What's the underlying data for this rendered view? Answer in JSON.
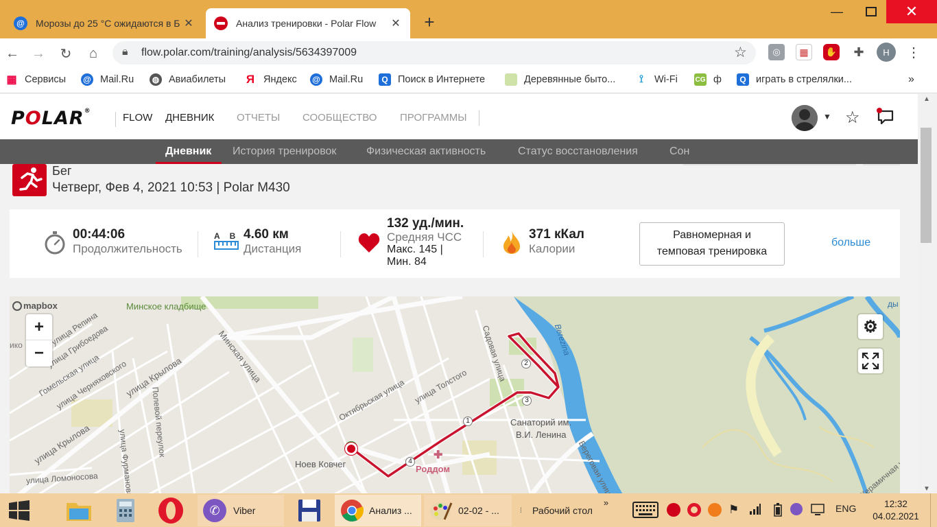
{
  "browser": {
    "tabs": [
      {
        "title": "Морозы до 25 °C ожидаются в Б",
        "active": false
      },
      {
        "title": "Анализ тренировки - Polar Flow",
        "active": true
      }
    ],
    "url": "flow.polar.com/training/analysis/5634397009",
    "profile_initial": "Н",
    "bookmarks": [
      "Сервисы",
      "Mail.Ru",
      "Авиабилеты",
      "Яндекс",
      "Mail.Ru",
      "Поиск в Интернете",
      "Деревянные быто...",
      "Wi-Fi",
      "ф",
      "играть в стрелялки..."
    ],
    "bookmarks_more": "»"
  },
  "site": {
    "logo": "POLAR",
    "logo_mark": "®",
    "product": "FLOW",
    "main_nav": [
      "ДНЕВНИК",
      "ОТЧЕТЫ",
      "СООБЩЕСТВО",
      "ПРОГРАММЫ"
    ],
    "sub_nav": [
      "Дневник",
      "История тренировок",
      "Физическая активность",
      "Статус восстановления",
      "Сон"
    ],
    "accent": "#d0021b"
  },
  "training": {
    "sport": "Бег",
    "datetime_device": "Четверг, Фев 4, 2021 10:53 | Polar M430",
    "duration_value": "00:44:06",
    "duration_label": "Продолжительность",
    "distance_a": "A",
    "distance_b": "B",
    "distance_value": "4.60 км",
    "distance_label": "Дистанция",
    "hr_value": "132 уд./мин.",
    "hr_label": "Средняя ЧСС",
    "hr_max": "Макс. 145  |",
    "hr_min": "Мин. 84",
    "calories_value": "371 кКал",
    "calories_label": "Калории",
    "training_type_line1": "Равномерная и",
    "training_type_line2": "темповая тренировка",
    "more": "больше"
  },
  "map": {
    "attribution": "mapbox",
    "zoom_in": "+",
    "zoom_out": "−",
    "labels": {
      "cemetery": "Минское кладбище",
      "repina": "улица Репина",
      "griboedova": "улица Грибоедова",
      "gomelskaya": "Гомельская улица",
      "chernyakhovskogo": "улица Черняховского",
      "krylova": "улица Крылова",
      "krylova2": "улица Крылова",
      "minskaya": "Минская улица",
      "oktyabrskaya": "Октябрьская улица",
      "tolstogo": "улица Толстого",
      "sadovaya": "Садовая улица",
      "berezina": "Berezina",
      "polevoy": "Полевой переулок",
      "furmanova": "улица Фурманова",
      "lomonosova": "улица Ломоносова",
      "kovcheg": "Ноев Ковчег",
      "roddom": "Роддом",
      "sanatory1": "Санаторий им.",
      "sanatory2": "В.И. Ленина",
      "beregovaya": "Береговая улица",
      "keramichnaya": "Керамичная улица",
      "left_cut": "ико",
      "right_cut": "ды"
    },
    "kilometer_markers": [
      "1",
      "2",
      "3",
      "4"
    ]
  },
  "taskbar": {
    "viber": "Viber",
    "chrome": "Анализ ...",
    "paint": "02-02 - ...",
    "desktop": "Рабочий стол",
    "desktop_chevron": "»",
    "language": "ENG",
    "time": "12:32",
    "date": "04.02.2021"
  }
}
